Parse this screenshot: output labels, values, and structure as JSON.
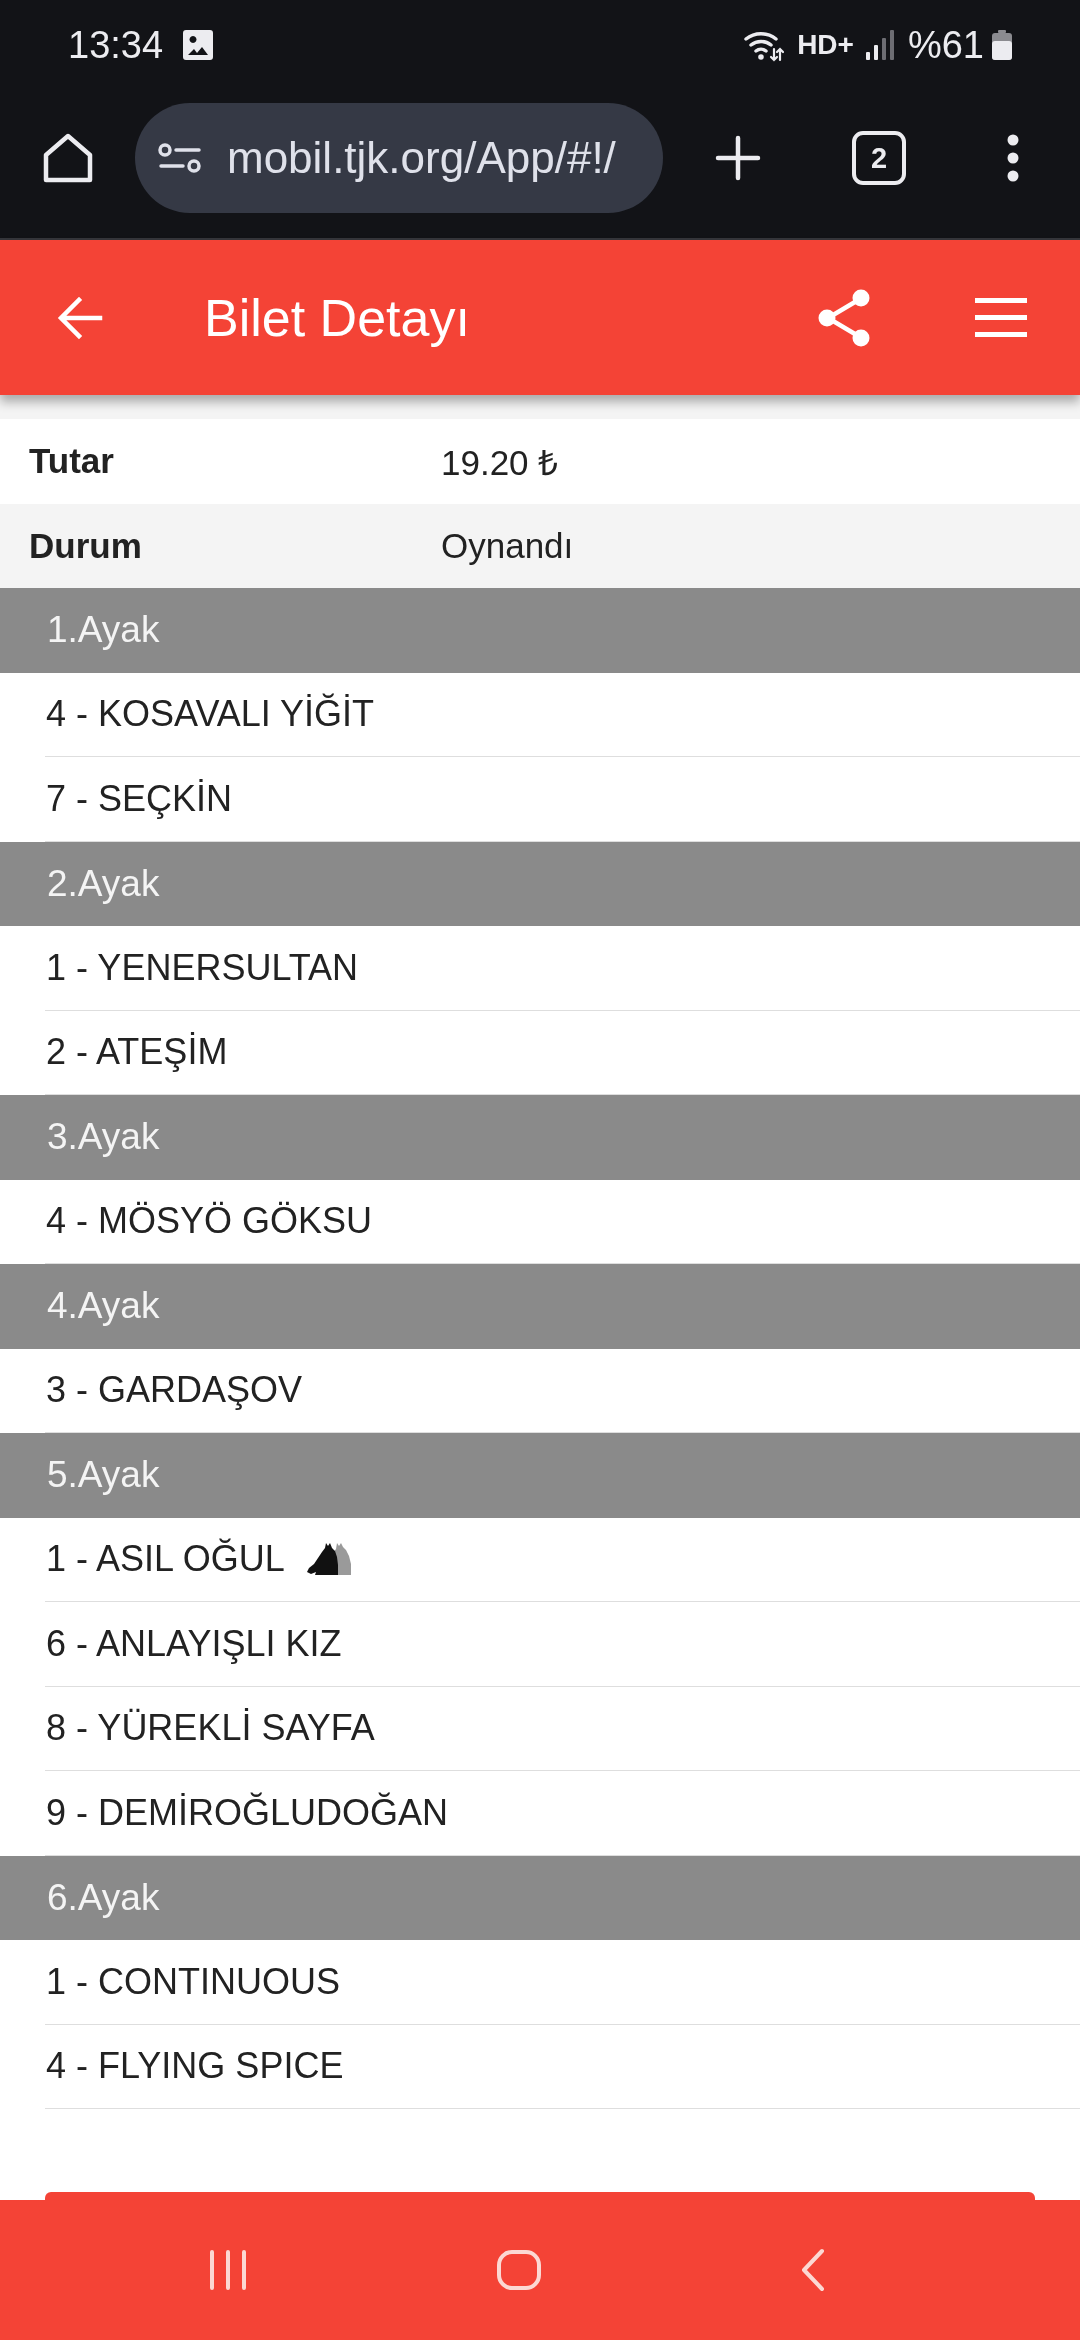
{
  "status_bar": {
    "time": "13:34",
    "call_badge": "HD+",
    "battery": "%61"
  },
  "browser": {
    "url": "mobil.tjk.org/App/#!/",
    "tab_count": "2"
  },
  "app_bar": {
    "title": "Bilet Detayı"
  },
  "details": [
    {
      "label": "Tutar",
      "value": "19.20 ₺"
    },
    {
      "label": "Durum",
      "value": "Oynandı"
    }
  ],
  "legs": [
    {
      "title": "1.Ayak",
      "horses": [
        {
          "name": "4 - KOSAVALI YİĞİT",
          "horse_icon": false
        },
        {
          "name": "7 - SEÇKİN",
          "horse_icon": false
        }
      ]
    },
    {
      "title": "2.Ayak",
      "horses": [
        {
          "name": "1 - YENERSULTAN",
          "horse_icon": false
        },
        {
          "name": "2 - ATEŞİM",
          "horse_icon": false
        }
      ]
    },
    {
      "title": "3.Ayak",
      "horses": [
        {
          "name": "4 - MÖSYÖ GÖKSU",
          "horse_icon": false
        }
      ]
    },
    {
      "title": "4.Ayak",
      "horses": [
        {
          "name": "3 - GARDAŞOV",
          "horse_icon": false
        }
      ]
    },
    {
      "title": "5.Ayak",
      "horses": [
        {
          "name": "1 - ASIL OĞUL",
          "horse_icon": true
        },
        {
          "name": "6 - ANLAYIŞLI KIZ",
          "horse_icon": false
        },
        {
          "name": "8 - YÜREKLİ SAYFA",
          "horse_icon": false
        },
        {
          "name": "9 - DEMİROĞLUDOĞAN",
          "horse_icon": false
        }
      ]
    },
    {
      "title": "6.Ayak",
      "horses": [
        {
          "name": "1 - CONTINUOUS",
          "horse_icon": false
        },
        {
          "name": "4 - FLYING SPICE",
          "horse_icon": false
        }
      ]
    }
  ]
}
